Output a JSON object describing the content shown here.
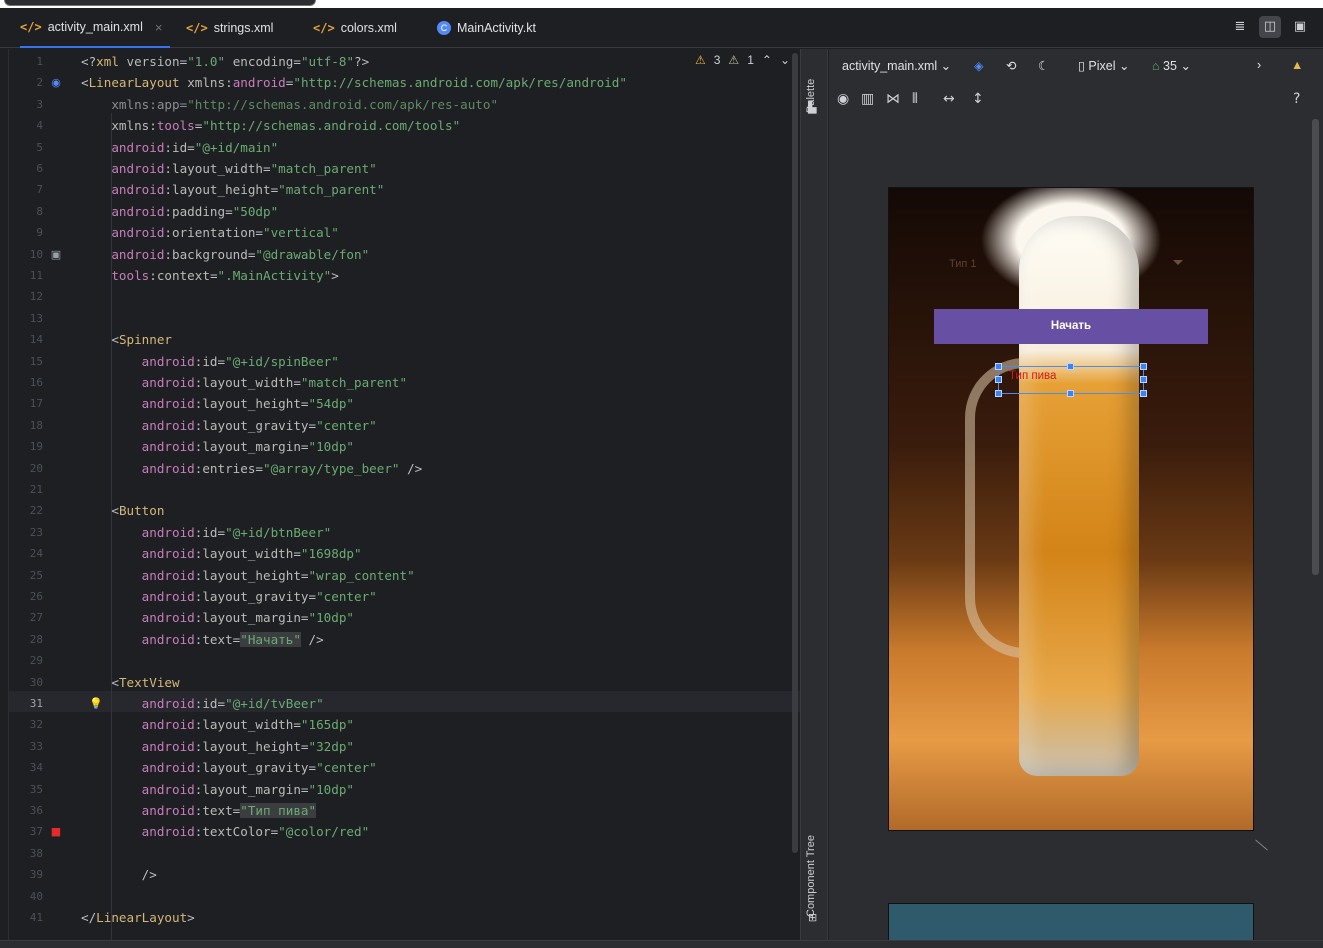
{
  "tabs": [
    {
      "label": "activity_main.xml",
      "type": "xml",
      "active": true
    },
    {
      "label": "strings.xml",
      "type": "xml",
      "active": false
    },
    {
      "label": "colors.xml",
      "type": "xml",
      "active": false
    },
    {
      "label": "MainActivity.kt",
      "type": "kt",
      "active": false
    }
  ],
  "inspection": {
    "warnings": "3",
    "weak_warnings": "1"
  },
  "code_lines": [
    {
      "n": "1",
      "html": "<span class='p'>&lt;?</span><span class='t'>xml</span> <span class='a'>version</span><span class='p'>=</span><span class='v'>\"1.0\"</span> <span class='a'>encoding</span><span class='p'>=</span><span class='v'>\"utf-8\"</span><span class='p'>?&gt;</span>"
    },
    {
      "n": "2",
      "html": "<span class='p'>&lt;</span><span class='t'>LinearLayout</span> <span class='a'>xmlns:</span><span class='n'>android</span><span class='p'>=</span><span class='v'>\"http://schemas.android.com/apk/res/android\"</span>"
    },
    {
      "n": "3",
      "html": "    <span class='a' style='color:#8a8d92'>xmlns:app</span><span class='p' style='color:#8a8d92'>=</span><span class='v' style='color:#5e8a63'>\"http://schemas.android.com/apk/res-auto\"</span>"
    },
    {
      "n": "4",
      "html": "    <span class='a'>xmlns:</span><span class='n'>tools</span><span class='p'>=</span><span class='v'>\"http://schemas.android.com/tools\"</span>"
    },
    {
      "n": "5",
      "html": "    <span class='n'>android</span><span class='a'>:id</span><span class='p'>=</span><span class='v'>\"@+id/main\"</span>"
    },
    {
      "n": "6",
      "html": "    <span class='n'>android</span><span class='a'>:layout_width</span><span class='p'>=</span><span class='v'>\"match_parent\"</span>"
    },
    {
      "n": "7",
      "html": "    <span class='n'>android</span><span class='a'>:layout_height</span><span class='p'>=</span><span class='v'>\"match_parent\"</span>"
    },
    {
      "n": "8",
      "html": "    <span class='n'>android</span><span class='a'>:padding</span><span class='p'>=</span><span class='v'>\"50dp\"</span>"
    },
    {
      "n": "9",
      "html": "    <span class='n'>android</span><span class='a'>:orientation</span><span class='p'>=</span><span class='v'>\"vertical\"</span>"
    },
    {
      "n": "10",
      "html": "    <span class='n'>android</span><span class='a'>:background</span><span class='p'>=</span><span class='v'>\"@drawable/fon\"</span>"
    },
    {
      "n": "11",
      "html": "    <span class='n'>tools</span><span class='a'>:context</span><span class='p'>=</span><span class='v'>\".MainActivity\"</span><span class='p'>&gt;</span>"
    },
    {
      "n": "12",
      "html": ""
    },
    {
      "n": "13",
      "html": ""
    },
    {
      "n": "14",
      "html": "    <span class='p'>&lt;</span><span class='t'>Spinner</span>"
    },
    {
      "n": "15",
      "html": "        <span class='n'>android</span><span class='a'>:id</span><span class='p'>=</span><span class='v'>\"@+id/spinBeer\"</span>"
    },
    {
      "n": "16",
      "html": "        <span class='n'>android</span><span class='a'>:layout_width</span><span class='p'>=</span><span class='v'>\"match_parent\"</span>"
    },
    {
      "n": "17",
      "html": "        <span class='n'>android</span><span class='a'>:layout_height</span><span class='p'>=</span><span class='v'>\"54dp\"</span>"
    },
    {
      "n": "18",
      "html": "        <span class='n'>android</span><span class='a'>:layout_gravity</span><span class='p'>=</span><span class='v'>\"center\"</span>"
    },
    {
      "n": "19",
      "html": "        <span class='n'>android</span><span class='a'>:layout_margin</span><span class='p'>=</span><span class='v'>\"10dp\"</span>"
    },
    {
      "n": "20",
      "html": "        <span class='n'>android</span><span class='a'>:entries</span><span class='p'>=</span><span class='v'>\"@array/type_beer\"</span> <span class='p'>/&gt;</span>"
    },
    {
      "n": "21",
      "html": ""
    },
    {
      "n": "22",
      "html": "    <span class='p'>&lt;</span><span class='t'>Button</span>"
    },
    {
      "n": "23",
      "html": "        <span class='n'>android</span><span class='a'>:id</span><span class='p'>=</span><span class='v'>\"@+id/btnBeer\"</span>"
    },
    {
      "n": "24",
      "html": "        <span class='n'>android</span><span class='a'>:layout_width</span><span class='p'>=</span><span class='v'>\"1698dp\"</span>"
    },
    {
      "n": "25",
      "html": "        <span class='n'>android</span><span class='a'>:layout_height</span><span class='p'>=</span><span class='v'>\"wrap_content\"</span>"
    },
    {
      "n": "26",
      "html": "        <span class='n'>android</span><span class='a'>:layout_gravity</span><span class='p'>=</span><span class='v'>\"center\"</span>"
    },
    {
      "n": "27",
      "html": "        <span class='n'>android</span><span class='a'>:layout_margin</span><span class='p'>=</span><span class='v'>\"10dp\"</span>"
    },
    {
      "n": "28",
      "html": "        <span class='n'>android</span><span class='a'>:text</span><span class='p'>=</span><span class='v hl'>\"Начать\"</span> <span class='p'>/&gt;</span>"
    },
    {
      "n": "29",
      "html": ""
    },
    {
      "n": "30",
      "html": "    <span class='p'>&lt;</span><span class='t'>TextView</span>"
    },
    {
      "n": "31",
      "html": "        <span class='n'>android</span><span class='a'>:id</span><span class='p'>=</span><span class='v'>\"@+id/tvBeer\"</span>"
    },
    {
      "n": "32",
      "html": "        <span class='n'>android</span><span class='a'>:layout_width</span><span class='p'>=</span><span class='v'>\"165dp\"</span>"
    },
    {
      "n": "33",
      "html": "        <span class='n'>android</span><span class='a'>:layout_height</span><span class='p'>=</span><span class='v'>\"32dp\"</span>"
    },
    {
      "n": "34",
      "html": "        <span class='n'>android</span><span class='a'>:layout_gravity</span><span class='p'>=</span><span class='v'>\"center\"</span>"
    },
    {
      "n": "35",
      "html": "        <span class='n'>android</span><span class='a'>:layout_margin</span><span class='p'>=</span><span class='v'>\"10dp\"</span>"
    },
    {
      "n": "36",
      "html": "        <span class='n'>android</span><span class='a'>:text</span><span class='p'>=</span><span class='v hl'>\"Тип пива\"</span>"
    },
    {
      "n": "37",
      "html": "        <span class='n'>android</span><span class='a'>:textColor</span><span class='p'>=</span><span class='v'>\"@color/red\"</span>"
    },
    {
      "n": "38",
      "html": ""
    },
    {
      "n": "39",
      "html": "        <span class='p'>/&gt;</span>"
    },
    {
      "n": "40",
      "html": ""
    },
    {
      "n": "41",
      "html": "<span class='p'>&lt;/</span><span class='t'>LinearLayout</span><span class='p'>&gt;</span>"
    }
  ],
  "current_line": "31",
  "side_labels": {
    "palette": "Palette",
    "component_tree": "Component Tree"
  },
  "design_toolbar": {
    "file": "activity_main.xml",
    "device": "Pixel",
    "api": "35"
  },
  "preview": {
    "spinner_text": "Тип 1",
    "button_text": "Начать",
    "textview_text": "Тип пива"
  },
  "colors": {
    "accent": "#3574f0",
    "button": "#6750a4",
    "text_red": "#d11b1b"
  }
}
